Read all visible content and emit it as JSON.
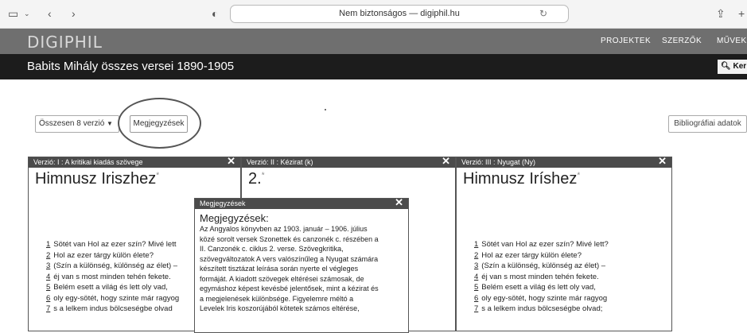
{
  "browser": {
    "url": "Nem biztonságos — digiphil.hu",
    "icons": [
      "sidebar-icon",
      "chevron-down-icon",
      "back-icon",
      "forward-icon",
      "shield-icon",
      "reload-icon",
      "share-icon",
      "new-tab-icon"
    ]
  },
  "header": {
    "logo": "DIGIPHIL",
    "nav": [
      "PROJEKTEK",
      "SZERZŐK",
      "MŰVEK"
    ]
  },
  "title_bar": {
    "title": "Babits Mihály összes versei 1890-1905",
    "search_label": "Ker"
  },
  "toolbar": {
    "versions_label": "Összesen 8 verzió",
    "notes_label": "Megjegyzések",
    "biblio_label": "Bibliográfiai adatok"
  },
  "panels": [
    {
      "header": "Verzió: I : A kritikai kiadás szövege",
      "title": "Himnusz Iriszhez",
      "lines": [
        {
          "n": "1",
          "t": "Sötét van Hol az ezer szín?  Mivé lett"
        },
        {
          "n": "2",
          "t": "Hol az ezer tárgy külön élete?"
        },
        {
          "n": "3",
          "t": "(Szín   a különség, különség az élet) –"
        },
        {
          "n": "4",
          "t": "éj   van s most minden tehén fekete."
        },
        {
          "n": "5",
          "t": "Belém esett a világ és lett oly vad,"
        },
        {
          "n": "6",
          "t": "oly egy-sötét, hogy szinte már ragyog"
        },
        {
          "n": "7",
          "t": "s   a lelkem indus bölcseségbe olvad"
        }
      ]
    },
    {
      "header": "Verzió: II : Kézirat (k)",
      "title": "2.",
      "lines": []
    },
    {
      "header": "Verzió: III : Nyugat (Ny)",
      "title": "Himnusz Iríshez",
      "lines": [
        {
          "n": "1",
          "t": "Sötét van Hol az ezer szín?  Mivé lett?"
        },
        {
          "n": "2",
          "t": "Hol az ezer tárgy külön élete?"
        },
        {
          "n": "3",
          "t": "(Szín   a különség, különség az élet) –"
        },
        {
          "n": "4",
          "t": "éj   van s most minden tehén fekete."
        },
        {
          "n": "5",
          "t": "Belém esett a világ és lett oly vad,"
        },
        {
          "n": "6",
          "t": "oly egy-sötét, hogy szinte már ragyog"
        },
        {
          "n": "7",
          "t": "s   a lelkem indus bölcseségbe olvad;"
        }
      ]
    }
  ],
  "notes_popup": {
    "header": "Megjegyzések",
    "heading": "Megjegyzések:",
    "body": [
      "Az Angyalos könyvben az 1903. január – 1906. július",
      "közé sorolt versek Szonettek és canzonék c. részében a",
      "II. Canzonék c. ciklus 2. verse. Szövegkritika,",
      "szövegváltozatok A vers valószínűleg a Nyugat számára",
      "készített tisztázat leírása során nyerte el végleges",
      "formáját. A kiadott szövegek eltérései számosak, de",
      "egymáshoz képest kevésbé jelentősek, mint a kézirat és",
      "a megjelenések különbsége. Figyelemre méltó a",
      "Levelek Iris koszorújából kötetek számos eltérése,"
    ]
  }
}
